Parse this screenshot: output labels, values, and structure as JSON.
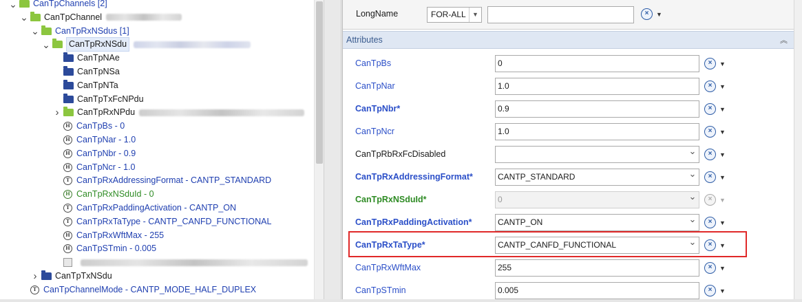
{
  "tree": {
    "nodes": [
      {
        "label": "CanTpChannels [2]",
        "expand": "v",
        "icon": "folder-green",
        "style": "channel",
        "indent": 0
      },
      {
        "label": "CanTpChannel",
        "expand": "v",
        "icon": "folder-green",
        "style": "dark",
        "indent": 1,
        "blurred": true
      },
      {
        "label": "CanTpRxNSdus [1]",
        "expand": "v",
        "icon": "folder-green",
        "style": "blue",
        "indent": 2
      },
      {
        "label": "CanTpRxNSdu",
        "expand": "v",
        "icon": "folder-green",
        "style": "dark",
        "indent": 3,
        "blurred": true,
        "selected": true
      },
      {
        "label": "CanTpNAe",
        "icon": "folder-blue",
        "style": "dark",
        "indent": 4
      },
      {
        "label": "CanTpNSa",
        "icon": "folder-blue",
        "style": "dark",
        "indent": 4
      },
      {
        "label": "CanTpNTa",
        "icon": "folder-blue",
        "style": "dark",
        "indent": 4
      },
      {
        "label": "CanTpTxFcNPdu",
        "icon": "folder-blue",
        "style": "dark",
        "indent": 4
      },
      {
        "label": "CanTpRxNPdu",
        "expand": ">",
        "icon": "folder-green",
        "style": "dark",
        "indent": 4,
        "blurred": true
      },
      {
        "label": "CanTpBs - 0",
        "icon": "param",
        "glyph": "H",
        "style": "blue",
        "indent": 4
      },
      {
        "label": "CanTpNar - 1.0",
        "icon": "param",
        "glyph": "H",
        "style": "blue",
        "indent": 4
      },
      {
        "label": "CanTpNbr - 0.9",
        "icon": "param",
        "glyph": "H",
        "style": "blue",
        "indent": 4
      },
      {
        "label": "CanTpNcr - 1.0",
        "icon": "param",
        "glyph": "H",
        "style": "blue",
        "indent": 4
      },
      {
        "label": "CanTpRxAddressingFormat - CANTP_STANDARD",
        "icon": "param",
        "glyph": "T",
        "style": "blue",
        "indent": 4
      },
      {
        "label": "CanTpRxNSduId - 0",
        "icon": "param",
        "glyph": "H",
        "style": "green",
        "indent": 4
      },
      {
        "label": "CanTpRxPaddingActivation - CANTP_ON",
        "icon": "param",
        "glyph": "T",
        "style": "blue",
        "indent": 4
      },
      {
        "label": "CanTpRxTaType - CANTP_CANFD_FUNCTIONAL",
        "icon": "param",
        "glyph": "T",
        "style": "blue",
        "indent": 4
      },
      {
        "label": "CanTpRxWftMax - 255",
        "icon": "param",
        "glyph": "H",
        "style": "blue",
        "indent": 4
      },
      {
        "label": "CanTpSTmin - 0.005",
        "icon": "param",
        "glyph": "H",
        "style": "blue",
        "indent": 4
      },
      {
        "label": "",
        "icon": "ref",
        "style": "dark",
        "indent": 4,
        "blurred": true
      },
      {
        "label": "CanTpTxNSdu",
        "expand": ">",
        "icon": "folder-blue",
        "style": "dark",
        "indent": 2
      },
      {
        "label": "CanTpChannelMode - CANTP_MODE_HALF_DUPLEX",
        "icon": "param",
        "glyph": "T",
        "style": "blue",
        "indent": 1
      }
    ]
  },
  "longname": {
    "label": "LongName",
    "language": "FOR-ALL",
    "value": ""
  },
  "attributes": {
    "title": "Attributes",
    "collapse_glyph": "︽",
    "rows": [
      {
        "label": "CanTpBs",
        "value": "0",
        "style": "blue",
        "kind": "text"
      },
      {
        "label": "CanTpNar",
        "value": "1.0",
        "style": "blue",
        "kind": "text"
      },
      {
        "label": "CanTpNbr*",
        "value": "0.9",
        "style": "blue-bold",
        "kind": "text"
      },
      {
        "label": "CanTpNcr",
        "value": "1.0",
        "style": "blue",
        "kind": "text"
      },
      {
        "label": "CanTpRbRxFcDisabled",
        "value": "",
        "style": "dark",
        "kind": "select"
      },
      {
        "label": "CanTpRxAddressingFormat*",
        "value": "CANTP_STANDARD",
        "style": "blue-bold",
        "kind": "select"
      },
      {
        "label": "CanTpRxNSduId*",
        "value": "0",
        "style": "green-bold",
        "kind": "disabled"
      },
      {
        "label": "CanTpRxPaddingActivation*",
        "value": "CANTP_ON",
        "style": "blue-bold",
        "kind": "select"
      },
      {
        "label": "CanTpRxTaType*",
        "value": "CANTP_CANFD_FUNCTIONAL",
        "style": "blue-bold",
        "kind": "select",
        "highlighted": true
      },
      {
        "label": "CanTpRxWftMax",
        "value": "255",
        "style": "blue",
        "kind": "text"
      },
      {
        "label": "CanTpSTmin",
        "value": "0.005",
        "style": "blue",
        "kind": "text"
      }
    ]
  },
  "colors": {
    "highlight": "#e02828",
    "link_blue": "#2b4fc8",
    "green": "#2e8b24",
    "header_bg": "#dfe7f3"
  }
}
